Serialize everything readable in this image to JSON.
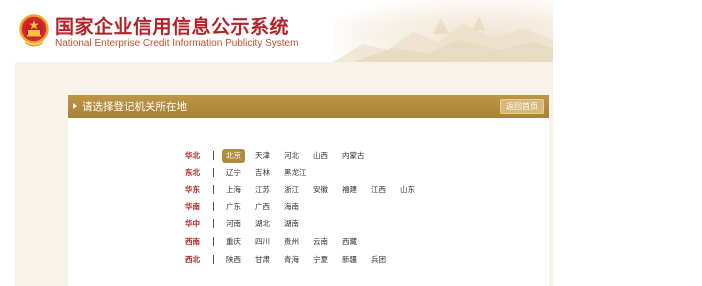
{
  "header": {
    "title": "国家企业信用信息公示系统",
    "subtitle": "National Enterprise Credit Information Publicity System"
  },
  "panel": {
    "title": "请选择登记机关所在地",
    "back_label": "返回首页"
  },
  "colors": {
    "brand_red": "#b1232a",
    "bar_gold": "#b08a3e",
    "page_beige": "#f7f3ea"
  },
  "regions": [
    {
      "name": "华北",
      "provinces": [
        "北京",
        "天津",
        "河北",
        "山西",
        "内蒙古"
      ],
      "selected": "北京"
    },
    {
      "name": "东北",
      "provinces": [
        "辽宁",
        "吉林",
        "黑龙江"
      ]
    },
    {
      "name": "华东",
      "provinces": [
        "上海",
        "江苏",
        "浙江",
        "安徽",
        "福建",
        "江西",
        "山东"
      ]
    },
    {
      "name": "华南",
      "provinces": [
        "广东",
        "广西",
        "海南"
      ]
    },
    {
      "name": "华中",
      "provinces": [
        "河南",
        "湖北",
        "湖南"
      ]
    },
    {
      "name": "西南",
      "provinces": [
        "重庆",
        "四川",
        "贵州",
        "云南",
        "西藏"
      ]
    },
    {
      "name": "西北",
      "provinces": [
        "陕西",
        "甘肃",
        "青海",
        "宁夏",
        "新疆",
        "兵团"
      ]
    }
  ]
}
